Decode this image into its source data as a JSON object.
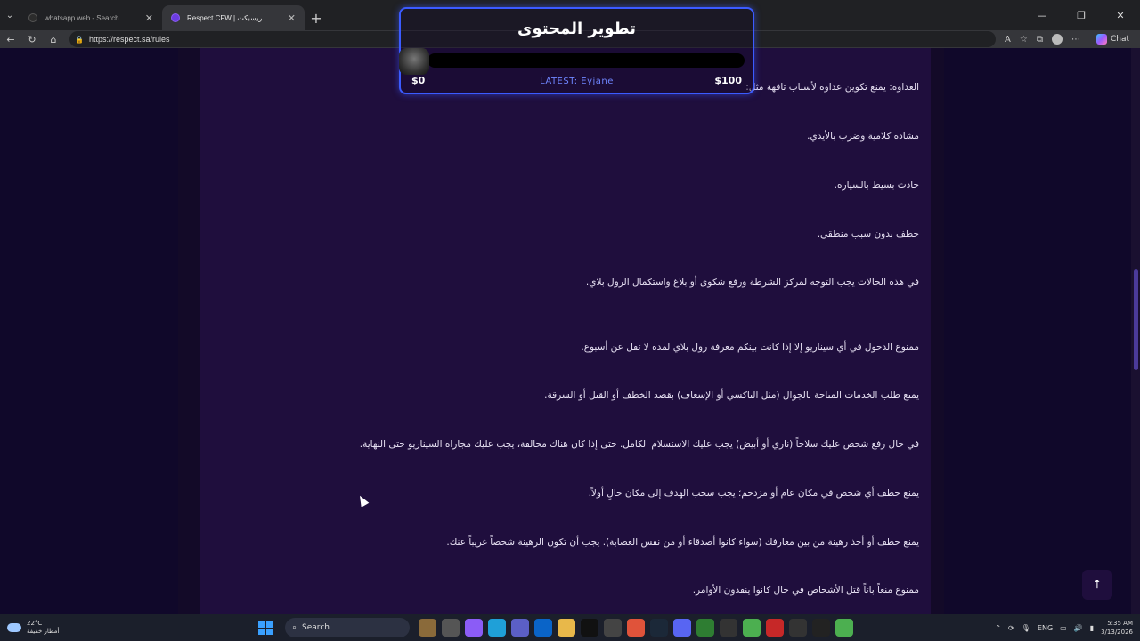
{
  "browser": {
    "tabs": [
      {
        "title": "whatsapp web - Search",
        "active": false
      },
      {
        "title": "Respect CFW | ريسبكت",
        "active": true
      }
    ],
    "url": "https://respect.sa/rules",
    "chat_label": "Chat"
  },
  "goal_widget": {
    "title": "تطوير المحتوى",
    "min_label": "$0",
    "max_label": "$100",
    "latest": "LATEST: Eyjane",
    "progress_fraction": 0.0
  },
  "rules": [
    "العداوة: يمنع تكوين عداوة لأسباب تافهة مثل:",
    "مشادة كلامية وضرب بالأيدي.",
    "حادث بسيط بالسيارة.",
    "خطف بدون سبب منطقي.",
    "في هذه الحالات يجب التوجه لمركز الشرطة ورفع شكوى أو بلاغ واستكمال الرول بلاي.",
    "ممنوع الدخول في أي سيناريو إلا إذا كانت بينكم معرفة رول بلاي لمدة لا تقل عن أسبوع.",
    "يمنع طلب الخدمات المتاحة بالجوال (مثل التاكسي أو الإسعاف) بقصد الخطف أو القتل أو السرقة.",
    "في حال رفع شخص عليك سلاحاً (ناري أو أبيض) يجب عليك الاستسلام الكامل. حتى إذا كان هناك مخالفة، يجب عليك مجاراة السيناريو حتى النهاية.",
    "يمنع خطف أي شخص في مكان عام أو مزدحم؛ يجب سحب الهدف إلى مكان خالٍ أولاً.",
    "يمنع خطف أو أخذ رهينة من بين معارفك (سواء كانوا أصدقاء أو من نفس العصابة). يجب أن تكون الرهينة شخصاً غريباً عنك.",
    "ممنوع منعاً باتاً قتل الأشخاص في حال كانوا ينفذون الأوامر."
  ],
  "taskbar": {
    "temperature": "22°C",
    "weather": "أمطار خفيفة",
    "search_label": "Search",
    "language": "ENG",
    "time": "5:35 AM",
    "date": "3/13/2026"
  }
}
